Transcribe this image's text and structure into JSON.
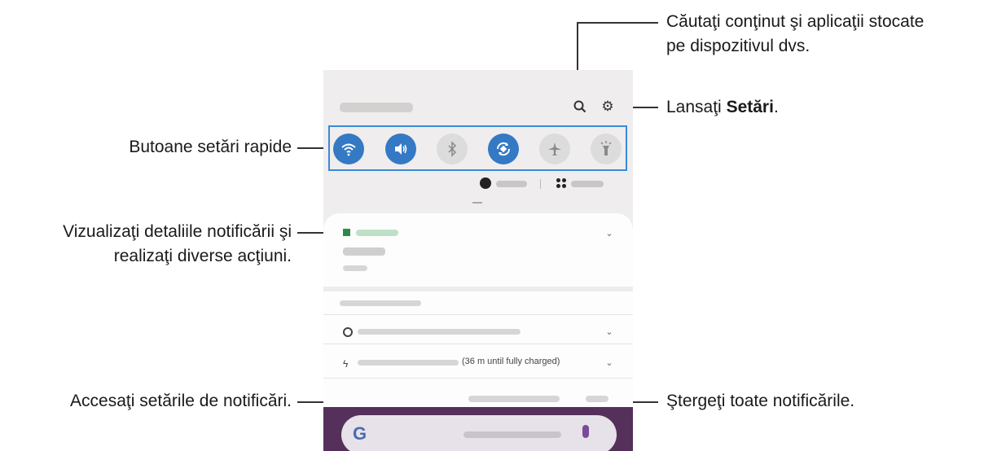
{
  "callouts": {
    "search": {
      "line1": "Căutaţi conţinut şi aplicaţii stocate",
      "line2": "pe dispozitivul dvs."
    },
    "settings": {
      "prefix": "Lansaţi ",
      "bold": "Setări",
      "suffix": "."
    },
    "quick_settings": "Butoane setări rapide",
    "notification": {
      "line1": "Vizualizaţi detaliile notificării şi",
      "line2": "realizaţi diverse acţiuni."
    },
    "notification_settings": "Accesaţi setările de notificări.",
    "clear": "Ştergeţi toate notificările."
  },
  "phone": {
    "charging_text": "(36 m until fully charged)",
    "search_bar_logo": "G"
  },
  "quick_settings_buttons": [
    {
      "name": "wifi",
      "icon": "wifi-icon",
      "state": "on"
    },
    {
      "name": "sound",
      "icon": "sound-icon",
      "state": "on"
    },
    {
      "name": "bluetooth",
      "icon": "bluetooth-icon",
      "state": "off"
    },
    {
      "name": "auto-rotate",
      "icon": "rotate-icon",
      "state": "on"
    },
    {
      "name": "airplane",
      "icon": "airplane-icon",
      "state": "off"
    },
    {
      "name": "flashlight",
      "icon": "flashlight-icon",
      "state": "off"
    }
  ],
  "colors": {
    "accent": "#3479c4",
    "highlight_box": "#3a8ad8",
    "wallpaper": "#55305a"
  }
}
